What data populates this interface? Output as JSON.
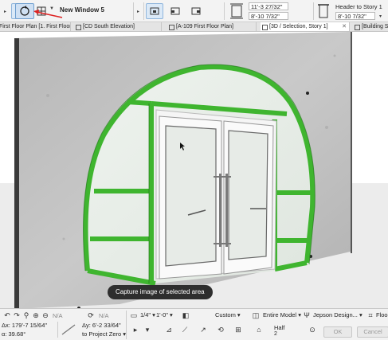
{
  "toolbar": {
    "window_name": "New Window 5",
    "dim1": "11'-3 27/32\"",
    "dim2": "8'-10 7/32\"",
    "header_label": "Header to Story 1",
    "header_value": "8'-10 7/32\""
  },
  "tabs": [
    {
      "label": "First Floor Plan [1. First Floor]",
      "active": false
    },
    {
      "label": "[CD South Elevation]",
      "active": false
    },
    {
      "label": "[A-109 First Floor Plan]",
      "active": false
    },
    {
      "label": "[3D / Selection, Story 1]",
      "active": true
    },
    {
      "label": "[Building S",
      "active": false
    }
  ],
  "viewport": {
    "tooltip": "Capture image of selected area",
    "selection_color": "#4cc43c"
  },
  "status": {
    "dx": "Δx: 179'-7 15/64\"",
    "dy": "Δy: 6'-2 33/64\"",
    "angle": "α: 39.68°",
    "project_zero": "to Project Zero",
    "na1": "N/A",
    "na2": "N/A",
    "scale": "1/4\"",
    "scale_value": "1'-0\"",
    "custom": "Custom",
    "entire_model": "Entire Model",
    "jepson": "Jepson Design...",
    "floor": "Floor",
    "half": "Half",
    "half_num": "2",
    "ok": "OK",
    "cancel": "Cancel"
  }
}
